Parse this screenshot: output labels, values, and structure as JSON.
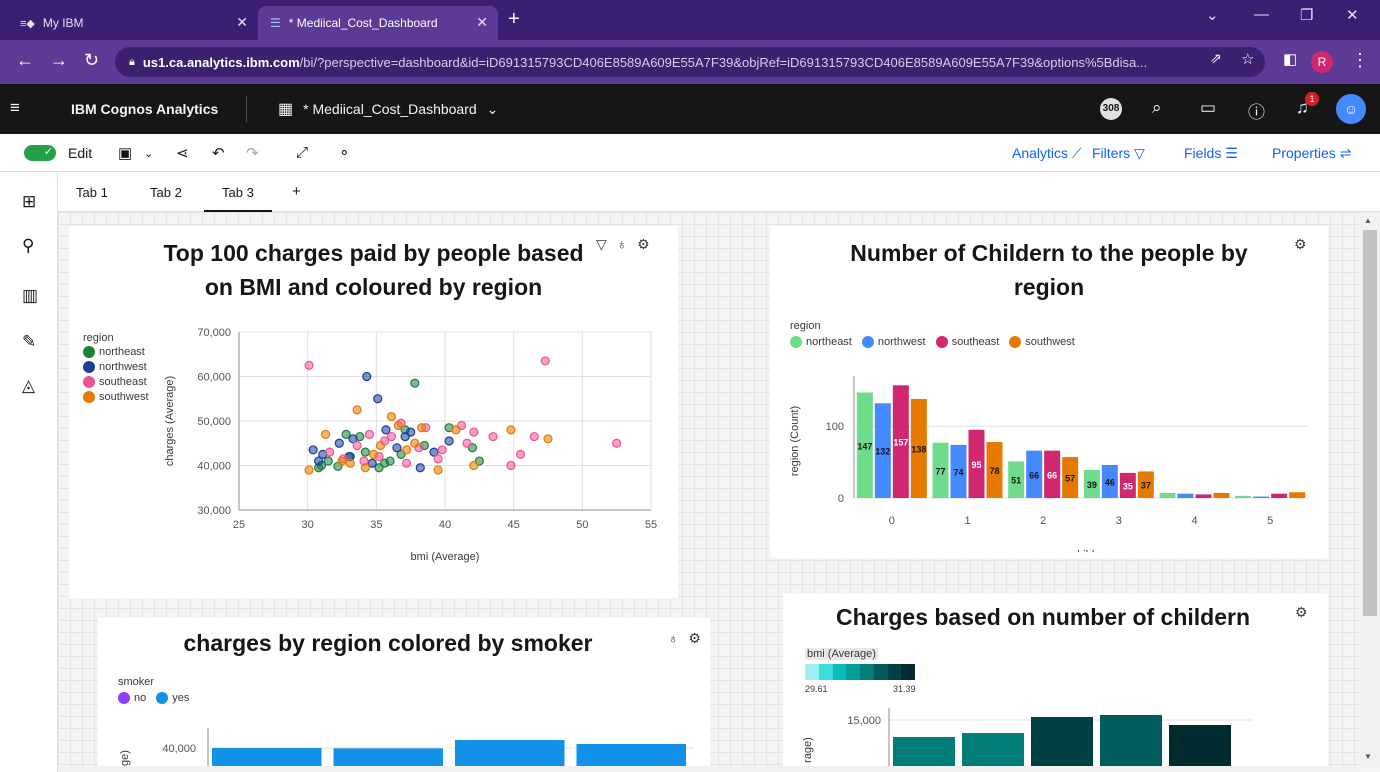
{
  "browser": {
    "tabs": [
      {
        "label": "My IBM"
      },
      {
        "label": "* Mediical_Cost_Dashboard"
      }
    ],
    "url_host": "us1.ca.analytics.ibm.com",
    "url_rest": "/bi/?perspective=dashboard&id=iD691315793CD406E8589A609E55A7F39&objRef=iD691315793CD406E8589A609E55A7F39&options%5Bdisa...",
    "profile_initial": "R"
  },
  "header": {
    "brand": "IBM Cognos Analytics",
    "dashboard_name": "* Mediical_Cost_Dashboard",
    "badge": "308",
    "notif_count": "1"
  },
  "toolbar": {
    "edit_label": "Edit",
    "analytics": "Analytics",
    "filters": "Filters",
    "fields": "Fields",
    "properties": "Properties"
  },
  "page_tabs": [
    "Tab 1",
    "Tab 2",
    "Tab 3",
    "+"
  ],
  "colors": {
    "northeast_scatter": "#198038",
    "northwest_scatter": "#1a3d9e",
    "southeast": "#ee5396",
    "southwest": "#e67a00",
    "northeast_bar": "#6fdc8c",
    "northwest_bar": "#4589ff",
    "southeast_bar": "#d12771",
    "southwest_bar": "#e67a00",
    "smoker_no": "#8a3ffc",
    "smoker_yes": "#1192e8"
  },
  "widgets": {
    "scatter": {
      "title_line1": "Top 100 charges paid by people based",
      "title_line2": "on BMI and coloured by region",
      "legend_title": "region",
      "legend": [
        "northeast",
        "northwest",
        "southeast",
        "southwest"
      ]
    },
    "children": {
      "title_line1": "Number of Childern to the people by",
      "title_line2": "region",
      "legend_title": "region",
      "legend": [
        "northeast",
        "northwest",
        "southeast",
        "southwest"
      ]
    },
    "smoker": {
      "title": "charges by region colored by smoker",
      "legend_title": "smoker",
      "legend": [
        "no",
        "yes"
      ]
    },
    "childcharges": {
      "title": "Charges based on number of childern",
      "legend_title": "bmi (Average)",
      "legend_min": "29.61",
      "legend_max": "31.39"
    }
  },
  "chart_data": [
    {
      "type": "scatter",
      "title": "Top 100 charges paid by people based on BMI and coloured by region",
      "xlabel": "bmi (Average)",
      "ylabel": "charges (Average)",
      "xlim": [
        25,
        55
      ],
      "ylim": [
        30000,
        70000
      ],
      "x_ticks": [
        "25",
        "30",
        "35",
        "40",
        "45",
        "50",
        "55"
      ],
      "y_ticks": [
        "30,000",
        "40,000",
        "50,000",
        "60,000",
        "70,000"
      ],
      "grid": true,
      "legend_position": "left",
      "series": [
        {
          "name": "northeast",
          "points": [
            [
              30.8,
              39500
            ],
            [
              31.5,
              41000
            ],
            [
              32.2,
              39800
            ],
            [
              33,
              42000
            ],
            [
              34.2,
              43000
            ],
            [
              35.2,
              39500
            ],
            [
              36,
              41000
            ],
            [
              37.1,
              48000
            ],
            [
              37.8,
              58500
            ],
            [
              40.3,
              48500
            ],
            [
              42.5,
              41000
            ],
            [
              42,
              44000
            ],
            [
              36.8,
              42500
            ],
            [
              33.8,
              46500
            ],
            [
              31,
              40000
            ],
            [
              38.5,
              44500
            ],
            [
              35.6,
              40500
            ],
            [
              32.8,
              47000
            ]
          ]
        },
        {
          "name": "northwest",
          "points": [
            [
              34.3,
              60000
            ],
            [
              35.1,
              55000
            ],
            [
              30.4,
              43500
            ],
            [
              31.1,
              42500
            ],
            [
              32.3,
              45000
            ],
            [
              33.3,
              46000
            ],
            [
              34.7,
              40500
            ],
            [
              36.5,
              44000
            ],
            [
              37.1,
              46500
            ],
            [
              38.2,
              39500
            ],
            [
              40.3,
              45500
            ],
            [
              35.7,
              48000
            ],
            [
              33.1,
              42000
            ],
            [
              37.5,
              47500
            ],
            [
              30.8,
              41000
            ],
            [
              39.2,
              43000
            ]
          ]
        },
        {
          "name": "southeast",
          "points": [
            [
              30.1,
              62500
            ],
            [
              47.3,
              63500
            ],
            [
              52.5,
              45000
            ],
            [
              31.6,
              43000
            ],
            [
              32.6,
              41500
            ],
            [
              33.6,
              44500
            ],
            [
              34.5,
              47000
            ],
            [
              35.2,
              42000
            ],
            [
              36.1,
              46500
            ],
            [
              37.2,
              40500
            ],
            [
              38.6,
              48500
            ],
            [
              39.5,
              41500
            ],
            [
              41.2,
              49000
            ],
            [
              42.1,
              47500
            ],
            [
              43.5,
              46500
            ],
            [
              45.5,
              42500
            ],
            [
              46.5,
              46500
            ],
            [
              36.8,
              49500
            ],
            [
              34.1,
              41000
            ],
            [
              39.8,
              43500
            ],
            [
              41.6,
              45000
            ],
            [
              44.8,
              40000
            ],
            [
              35.6,
              45500
            ],
            [
              38.1,
              44000
            ]
          ]
        },
        {
          "name": "southwest",
          "points": [
            [
              30.1,
              39000
            ],
            [
              31.3,
              47000
            ],
            [
              32.5,
              41000
            ],
            [
              33.6,
              52500
            ],
            [
              34.8,
              42500
            ],
            [
              36.1,
              51000
            ],
            [
              37.2,
              43500
            ],
            [
              38.3,
              48500
            ],
            [
              39.5,
              39000
            ],
            [
              42.1,
              40000
            ],
            [
              44.8,
              48000
            ],
            [
              47.5,
              46000
            ],
            [
              36.6,
              49000
            ],
            [
              35.3,
              44500
            ],
            [
              33.1,
              40500
            ],
            [
              37.8,
              45000
            ],
            [
              40.8,
              48000
            ],
            [
              34.2,
              39500
            ]
          ]
        }
      ]
    },
    {
      "type": "bar",
      "title": "Number of Childern to the people by region",
      "xlabel": "children",
      "ylabel": "region (Count)",
      "categories": [
        "0",
        "1",
        "2",
        "3",
        "4",
        "5"
      ],
      "ylim": [
        0,
        170
      ],
      "y_ticks": [
        "0",
        "100"
      ],
      "legend_position": "top-left",
      "series": [
        {
          "name": "northeast",
          "values": [
            147,
            77,
            51,
            39,
            7,
            3
          ]
        },
        {
          "name": "northwest",
          "values": [
            132,
            74,
            66,
            46,
            6,
            2
          ]
        },
        {
          "name": "southeast",
          "values": [
            157,
            95,
            66,
            35,
            5,
            6
          ]
        },
        {
          "name": "southwest",
          "values": [
            138,
            78,
            57,
            37,
            7,
            8
          ]
        }
      ],
      "data_labels": [
        [
          "147",
          "77",
          "51",
          "39",
          "",
          ""
        ],
        [
          "132",
          "74",
          "66",
          "46",
          "",
          ""
        ],
        [
          "157",
          "95",
          "66",
          "35",
          "",
          ""
        ],
        [
          "138",
          "78",
          "57",
          "37",
          "",
          ""
        ]
      ]
    },
    {
      "type": "bar",
      "title": "charges by region colored by smoker",
      "ylabel": "",
      "y_ticks": [
        "40,000"
      ],
      "ylim": [
        30000,
        45000
      ],
      "legend_position": "top-left",
      "series": [
        {
          "name": "yes",
          "values": [
            40000,
            39900,
            42000,
            41000
          ]
        }
      ]
    },
    {
      "type": "bar",
      "title": "Charges based on number of childern",
      "ylabel": "",
      "y_ticks": [
        "15,000"
      ],
      "ylim": [
        8000,
        16000
      ],
      "legend_position": "top-left",
      "color_scale": {
        "name": "bmi (Average)",
        "min": 29.61,
        "max": 31.39
      },
      "values": [
        13100,
        13500,
        15100,
        15300,
        14300
      ],
      "bmi_values": [
        30.5,
        30.6,
        31.2,
        30.9,
        31.39
      ]
    }
  ]
}
